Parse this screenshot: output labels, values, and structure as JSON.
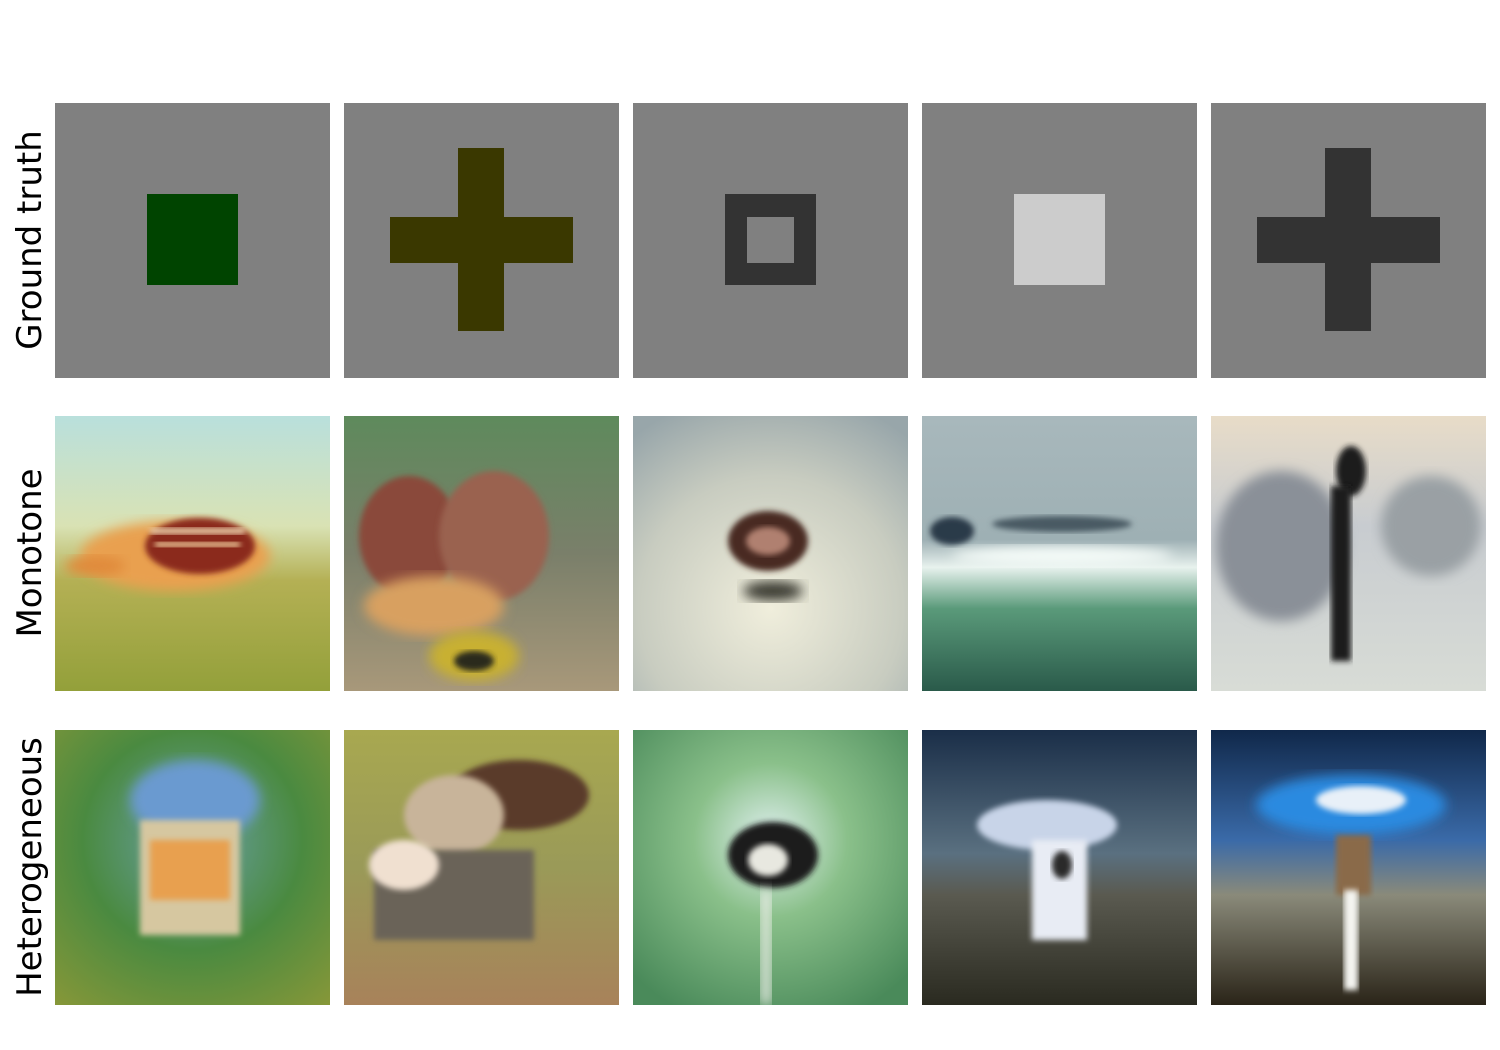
{
  "rows": [
    {
      "label": "Ground truth"
    },
    {
      "label": "Monotone"
    },
    {
      "label": "Heterogeneous"
    }
  ],
  "stimuli": [
    {
      "shape": "square",
      "color": "#004400"
    },
    {
      "shape": "cross",
      "color": "#3a3800"
    },
    {
      "shape": "square-outline",
      "color": "#333333"
    },
    {
      "shape": "square",
      "color": "#cccccc"
    },
    {
      "shape": "cross",
      "color": "#333333"
    }
  ],
  "colors": {
    "stimulus_background": "#808080"
  }
}
